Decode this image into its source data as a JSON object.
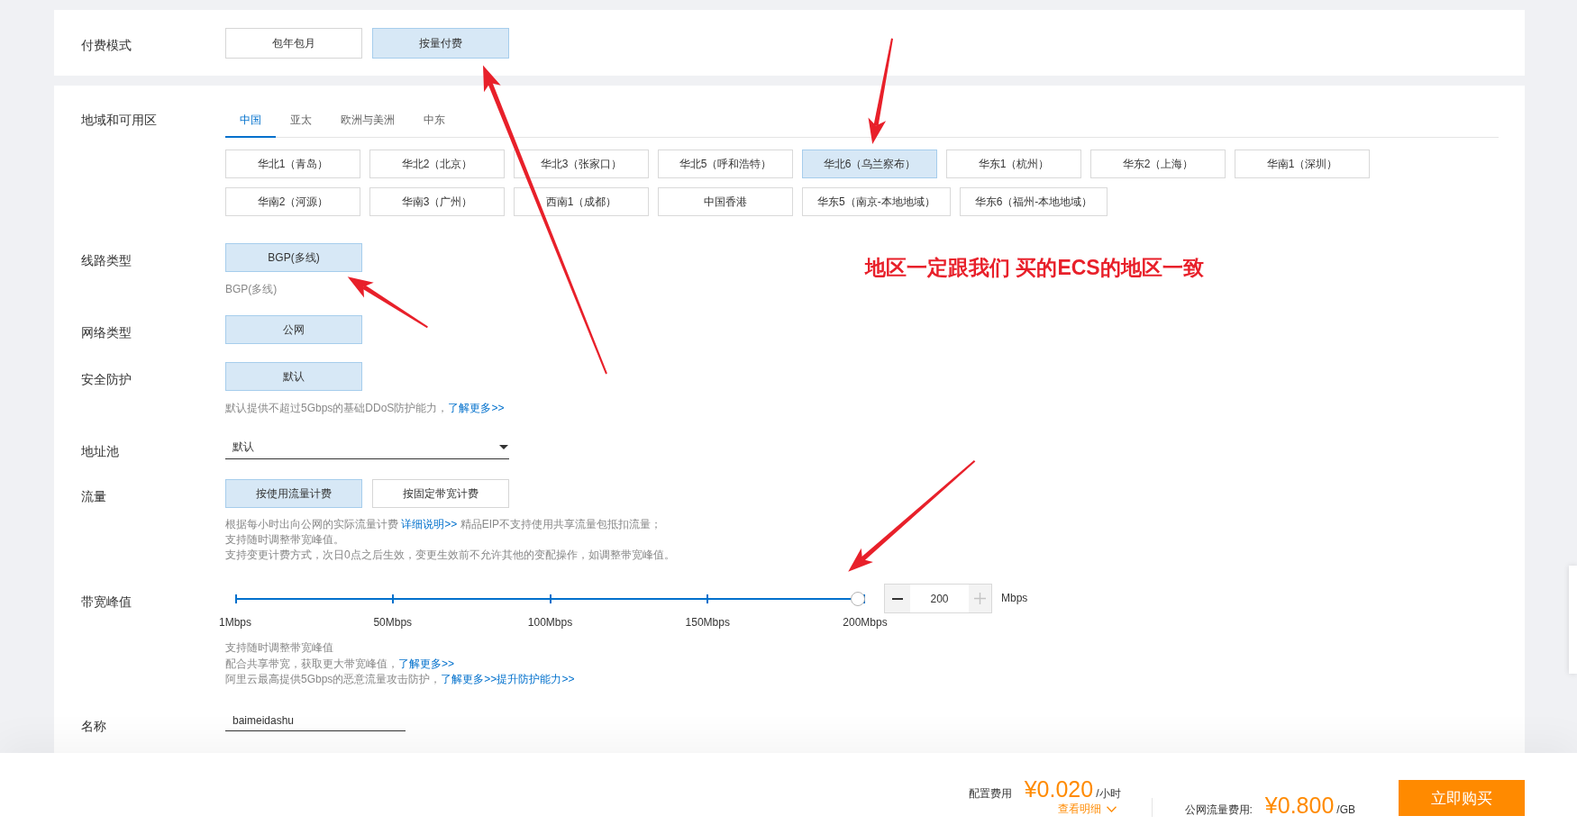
{
  "billing": {
    "label": "付费模式",
    "options": [
      {
        "label": "包年包月",
        "selected": false
      },
      {
        "label": "按量付费",
        "selected": true
      }
    ]
  },
  "region": {
    "label": "地域和可用区",
    "tabs": [
      {
        "label": "中国",
        "selected": true
      },
      {
        "label": "亚太",
        "selected": false
      },
      {
        "label": "欧洲与美洲",
        "selected": false
      },
      {
        "label": "中东",
        "selected": false
      }
    ],
    "zones": [
      {
        "label": "华北1（青岛）",
        "selected": false
      },
      {
        "label": "华北2（北京）",
        "selected": false
      },
      {
        "label": "华北3（张家口）",
        "selected": false
      },
      {
        "label": "华北5（呼和浩特）",
        "selected": false
      },
      {
        "label": "华北6（乌兰察布）",
        "selected": true
      },
      {
        "label": "华东1（杭州）",
        "selected": false
      },
      {
        "label": "华东2（上海）",
        "selected": false
      },
      {
        "label": "华南1（深圳）",
        "selected": false
      },
      {
        "label": "华南2（河源）",
        "selected": false
      },
      {
        "label": "华南3（广州）",
        "selected": false
      },
      {
        "label": "西南1（成都）",
        "selected": false
      },
      {
        "label": "中国香港",
        "selected": false
      },
      {
        "label": "华东5（南京-本地地域）",
        "selected": false
      },
      {
        "label": "华东6（福州-本地地域）",
        "selected": false
      }
    ]
  },
  "line_type": {
    "label": "线路类型",
    "options": [
      {
        "label": "BGP(多线)",
        "selected": true
      }
    ],
    "note": "BGP(多线)"
  },
  "network_type": {
    "label": "网络类型",
    "options": [
      {
        "label": "公网",
        "selected": true
      }
    ]
  },
  "security": {
    "label": "安全防护",
    "options": [
      {
        "label": "默认",
        "selected": true
      }
    ],
    "note": [
      [
        {
          "kind": "text",
          "text": "默认提供不超过5Gbps的基础DDoS防护能力，"
        },
        {
          "kind": "link",
          "text": "了解更多>>"
        }
      ]
    ]
  },
  "address_pool": {
    "label": "地址池",
    "value": "默认"
  },
  "traffic": {
    "label": "流量",
    "options": [
      {
        "label": "按使用流量计费",
        "selected": true
      },
      {
        "label": "按固定带宽计费",
        "selected": false
      }
    ],
    "note": [
      [
        {
          "kind": "text",
          "text": "根据每小时出向公网的实际流量计费 "
        },
        {
          "kind": "link",
          "text": "详细说明>>"
        },
        {
          "kind": "text",
          "text": " 精品EIP不支持使用共享流量包抵扣流量；"
        }
      ],
      [
        {
          "kind": "text",
          "text": "支持随时调整带宽峰值。"
        }
      ],
      [
        {
          "kind": "text",
          "text": "支持变更计费方式，次日0点之后生效，变更生效前不允许其他的变配操作，如调整带宽峰值。"
        }
      ]
    ]
  },
  "bandwidth": {
    "label": "带宽峰值",
    "level": 1,
    "ticks": [
      "1Mbps",
      "50Mbps",
      "100Mbps",
      "150Mbps",
      "200Mbps"
    ],
    "stepper": {
      "value": "200",
      "decrease_disabled": false,
      "increase_disabled": true
    },
    "unit": "Mbps",
    "note": [
      [
        {
          "kind": "text",
          "text": "支持随时调整带宽峰值"
        }
      ],
      [
        {
          "kind": "text",
          "text": "配合共享带宽，获取更大带宽峰值，"
        },
        {
          "kind": "link",
          "text": "了解更多>>"
        }
      ],
      [
        {
          "kind": "text",
          "text": "阿里云最高提供5Gbps的恶意流量攻击防护，"
        },
        {
          "kind": "link",
          "text": "了解更多>>"
        },
        {
          "kind": "link",
          "text": "提升防护能力>>"
        }
      ]
    ]
  },
  "name": {
    "label": "名称",
    "value": "baimeidashu"
  },
  "footer": {
    "config_label": "配置费用",
    "config_price": "¥0.020",
    "config_unit": "/小时",
    "details_link": "查看明细",
    "traffic_label": "公网流量费用:",
    "traffic_price": "¥0.800",
    "traffic_unit": "/GB",
    "buy_button": "立即购买"
  },
  "annotation": {
    "text": "地区一定跟我们 买的ECS的地区一致"
  }
}
